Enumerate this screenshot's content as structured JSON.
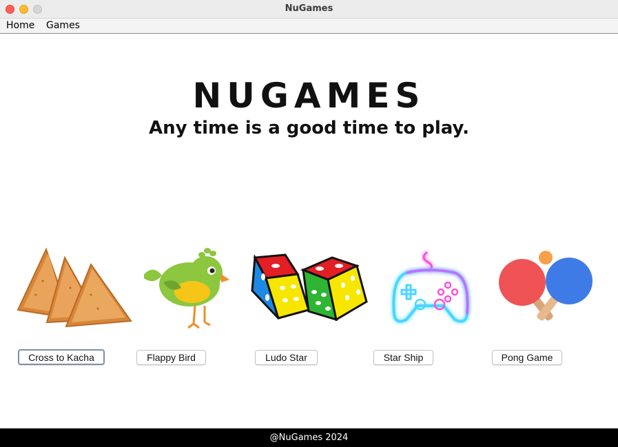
{
  "window": {
    "title": "NuGames"
  },
  "menu": {
    "home": "Home",
    "games": "Games"
  },
  "hero": {
    "brand": "NUGAMES",
    "tagline": "Any time is a good time to play."
  },
  "games": [
    {
      "label": "Cross to Kacha",
      "icon": "samosa-icon"
    },
    {
      "label": "Flappy Bird",
      "icon": "bird-icon"
    },
    {
      "label": "Ludo Star",
      "icon": "dice-icon"
    },
    {
      "label": "Star Ship",
      "icon": "gamepad-icon"
    },
    {
      "label": "Pong Game",
      "icon": "ping-pong-icon"
    }
  ],
  "footer": {
    "text": "@NuGames 2024"
  },
  "colors": {
    "samosa": "#e29a4a",
    "bird_body": "#8dc63f",
    "bird_belly": "#f5c518",
    "dice_red": "#e31e24",
    "dice_yellow": "#f7e600",
    "dice_blue": "#1e88e5",
    "dice_green": "#2fb534",
    "neon_blue": "#4ad7ff",
    "neon_pink": "#ff4fd8",
    "paddle_red": "#ef5356",
    "paddle_blue": "#3f7be6",
    "ball": "#f7a04b"
  }
}
